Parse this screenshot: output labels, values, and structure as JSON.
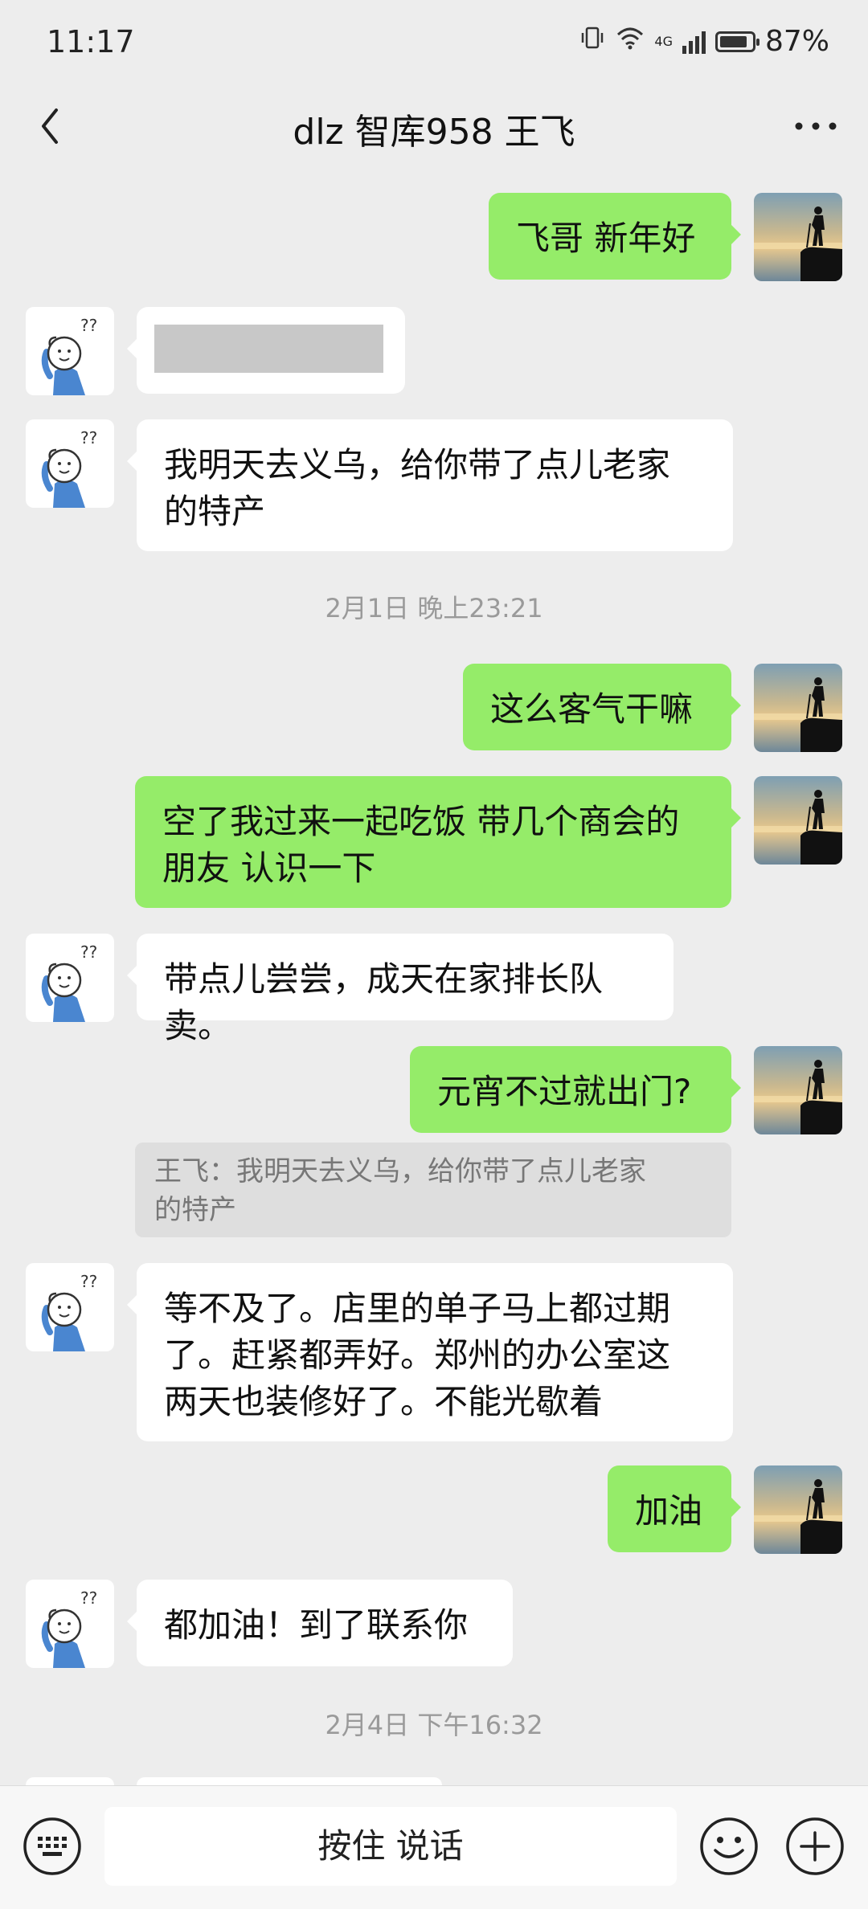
{
  "status_bar": {
    "time": "11:17",
    "network": "4G",
    "battery_text": "87%",
    "battery_level": 0.87
  },
  "header": {
    "title": "dlz 智库958 王飞"
  },
  "messages": [
    {
      "id": "m1",
      "side": "out",
      "text": "飞哥 新年好"
    },
    {
      "id": "m2",
      "side": "in",
      "redacted": true,
      "text": ""
    },
    {
      "id": "m3",
      "side": "in",
      "lines": [
        "我明天去义乌，给你带了点儿老家",
        "的特产"
      ]
    },
    {
      "id": "t1",
      "type": "timestamp",
      "text": "2月1日 晚上23:21"
    },
    {
      "id": "m4",
      "side": "out",
      "text": "这么客气干嘛"
    },
    {
      "id": "m5",
      "side": "out",
      "lines": [
        "空了我过来一起吃饭 带几个商会的",
        "朋友 认识一下"
      ]
    },
    {
      "id": "m6",
      "side": "in",
      "text": "带点儿尝尝，成天在家排长队卖。"
    },
    {
      "id": "m7",
      "side": "out",
      "text": "元宵不过就出门?"
    },
    {
      "id": "q1",
      "type": "quote",
      "lines": [
        "王飞：我明天去义乌，给你带了点儿老家",
        "的特产"
      ]
    },
    {
      "id": "m8",
      "side": "in",
      "lines": [
        "等不及了。店里的单子马上都过期",
        "了。赶紧都弄好。郑州的办公室这",
        "两天也装修好了。不能光歇着"
      ]
    },
    {
      "id": "m9",
      "side": "out",
      "text": "加油"
    },
    {
      "id": "m10",
      "side": "in",
      "text": "都加油！到了联系你"
    },
    {
      "id": "t2",
      "type": "timestamp",
      "text": "2月4日 下午16:32"
    }
  ],
  "input_bar": {
    "voice_label": "按住 说话"
  },
  "colors": {
    "background": "#ededed",
    "outgoing_bubble": "#95ec69",
    "incoming_bubble": "#ffffff",
    "timestamp_text": "#9a9a9a"
  },
  "icons": [
    "back-icon",
    "more-icon",
    "keyboard-icon",
    "emoji-icon",
    "plus-icon"
  ]
}
